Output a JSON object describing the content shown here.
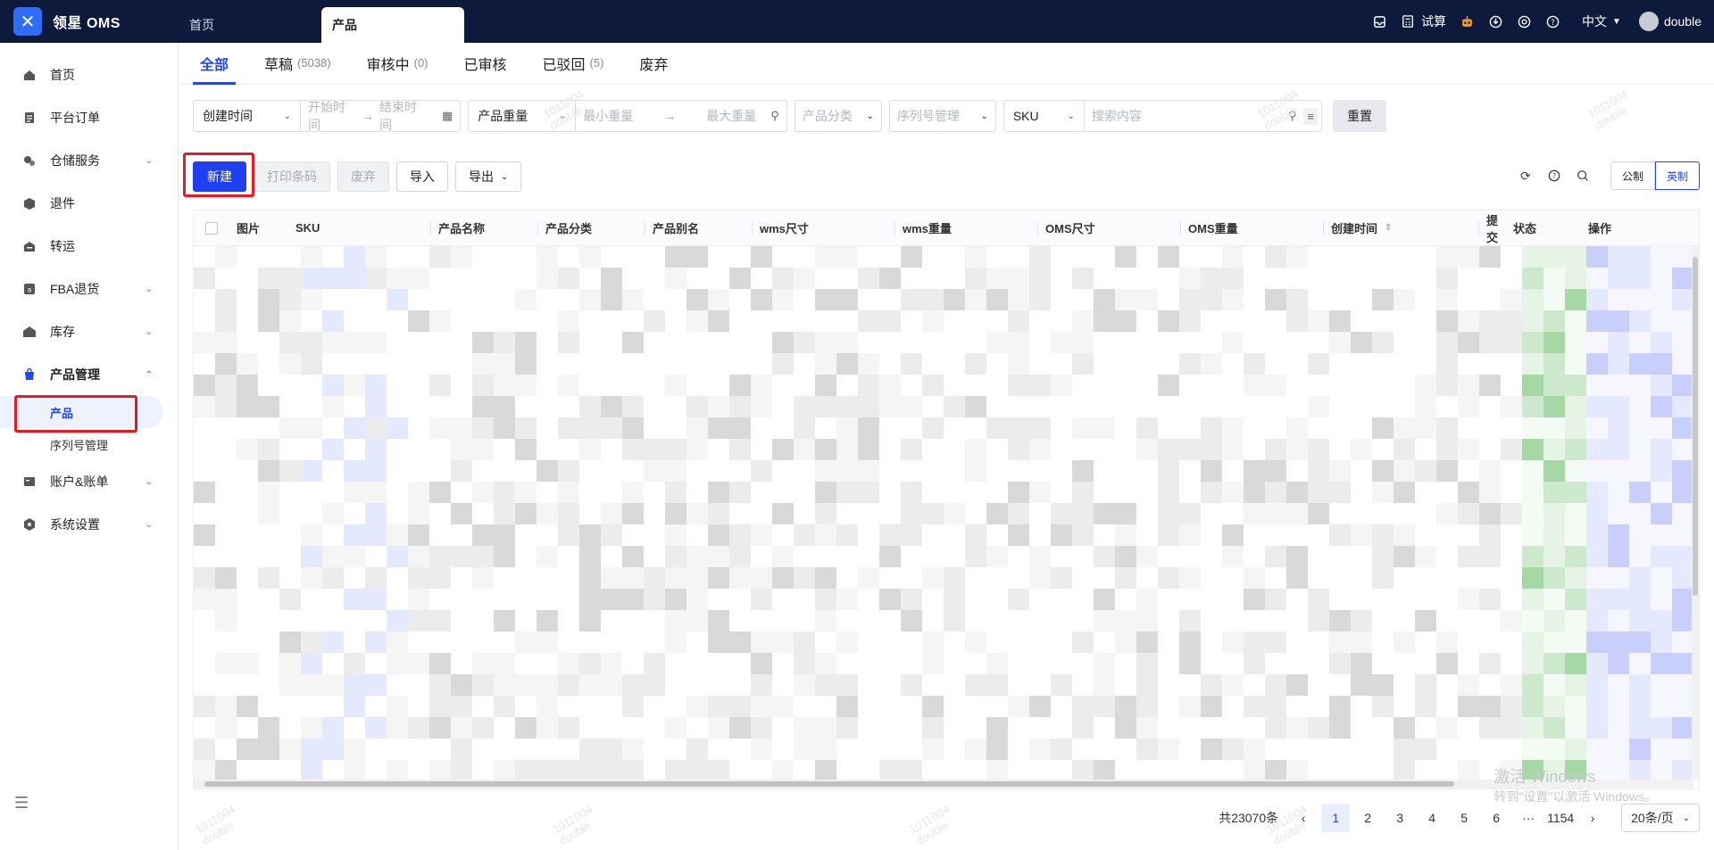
{
  "app": {
    "logo_text": "领星 OMS"
  },
  "top_tabs": [
    {
      "label": "首页"
    },
    {
      "label": "产品"
    }
  ],
  "top_right": {
    "trial": "试算",
    "language": "中文",
    "user": "double"
  },
  "sidebar": {
    "items": [
      {
        "label": "首页",
        "icon": "home-icon"
      },
      {
        "label": "平台订单",
        "icon": "clipboard-icon"
      },
      {
        "label": "仓储服务",
        "icon": "warehouse-icon"
      },
      {
        "label": "退件",
        "icon": "box-return-icon"
      },
      {
        "label": "转运",
        "icon": "transit-icon"
      },
      {
        "label": "FBA退货",
        "icon": "fba-icon"
      },
      {
        "label": "库存",
        "icon": "inventory-icon"
      },
      {
        "label": "产品管理",
        "icon": "bag-icon"
      },
      {
        "label": "账户&账单",
        "icon": "account-icon"
      },
      {
        "label": "系统设置",
        "icon": "settings-icon"
      }
    ],
    "sub_items": [
      {
        "label": "产品"
      },
      {
        "label": "序列号管理"
      }
    ]
  },
  "subtabs": [
    {
      "label": "全部",
      "count": ""
    },
    {
      "label": "草稿",
      "count": "(5038)"
    },
    {
      "label": "审核中",
      "count": "(0)"
    },
    {
      "label": "已审核",
      "count": ""
    },
    {
      "label": "已驳回",
      "count": "(5)"
    },
    {
      "label": "废弃",
      "count": ""
    }
  ],
  "filters": {
    "date_select": "创建时间",
    "start_placeholder": "开始时间",
    "end_placeholder": "结束时间",
    "weight_select": "产品重量",
    "min_weight_placeholder": "最小重量",
    "max_weight_placeholder": "最大重量",
    "category_placeholder": "产品分类",
    "serial_placeholder": "序列号管理",
    "sku_select": "SKU",
    "search_placeholder": "搜索内容",
    "reset_label": "重置"
  },
  "actions": {
    "new_label": "新建",
    "print_label": "打印条码",
    "discard_label": "废弃",
    "import_label": "导入",
    "export_label": "导出",
    "unit_metric": "公制",
    "unit_imperial": "英制"
  },
  "table": {
    "columns": [
      "图片",
      "SKU",
      "产品名称",
      "产品分类",
      "产品别名",
      "wms尺寸",
      "wms重量",
      "OMS尺寸",
      "OMS重量",
      "创建时间",
      "提交",
      "状态",
      "操作"
    ]
  },
  "pagination": {
    "total": "共23070条",
    "pages": [
      "1",
      "2",
      "3",
      "4",
      "5",
      "6",
      "···",
      "1154"
    ],
    "current": "1",
    "page_size": "20条/页"
  },
  "watermark": {
    "code": "1011004",
    "user": "double"
  },
  "os_overlay": {
    "title": "激活 Windows",
    "subtitle": "转到\"设置\"以激活 Windows。"
  },
  "colors": {
    "topbar": "#0d1a3c",
    "accent": "#2448e6",
    "primary_button": "#1f3ff0",
    "highlight": "#e31b23"
  }
}
